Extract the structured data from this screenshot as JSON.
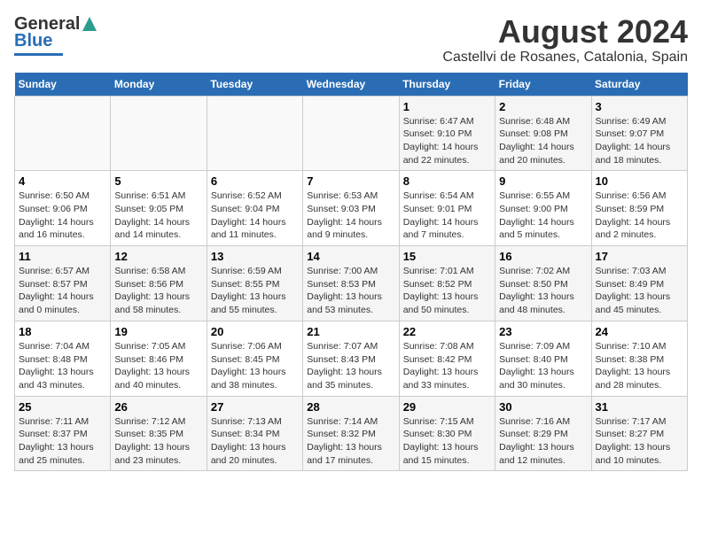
{
  "header": {
    "logo_line1": "General",
    "logo_line2": "Blue",
    "title": "August 2024",
    "subtitle": "Castellvi de Rosanes, Catalonia, Spain"
  },
  "calendar": {
    "days_of_week": [
      "Sunday",
      "Monday",
      "Tuesday",
      "Wednesday",
      "Thursday",
      "Friday",
      "Saturday"
    ],
    "weeks": [
      [
        {
          "day": "",
          "info": ""
        },
        {
          "day": "",
          "info": ""
        },
        {
          "day": "",
          "info": ""
        },
        {
          "day": "",
          "info": ""
        },
        {
          "day": "1",
          "info": "Sunrise: 6:47 AM\nSunset: 9:10 PM\nDaylight: 14 hours\nand 22 minutes."
        },
        {
          "day": "2",
          "info": "Sunrise: 6:48 AM\nSunset: 9:08 PM\nDaylight: 14 hours\nand 20 minutes."
        },
        {
          "day": "3",
          "info": "Sunrise: 6:49 AM\nSunset: 9:07 PM\nDaylight: 14 hours\nand 18 minutes."
        }
      ],
      [
        {
          "day": "4",
          "info": "Sunrise: 6:50 AM\nSunset: 9:06 PM\nDaylight: 14 hours\nand 16 minutes."
        },
        {
          "day": "5",
          "info": "Sunrise: 6:51 AM\nSunset: 9:05 PM\nDaylight: 14 hours\nand 14 minutes."
        },
        {
          "day": "6",
          "info": "Sunrise: 6:52 AM\nSunset: 9:04 PM\nDaylight: 14 hours\nand 11 minutes."
        },
        {
          "day": "7",
          "info": "Sunrise: 6:53 AM\nSunset: 9:03 PM\nDaylight: 14 hours\nand 9 minutes."
        },
        {
          "day": "8",
          "info": "Sunrise: 6:54 AM\nSunset: 9:01 PM\nDaylight: 14 hours\nand 7 minutes."
        },
        {
          "day": "9",
          "info": "Sunrise: 6:55 AM\nSunset: 9:00 PM\nDaylight: 14 hours\nand 5 minutes."
        },
        {
          "day": "10",
          "info": "Sunrise: 6:56 AM\nSunset: 8:59 PM\nDaylight: 14 hours\nand 2 minutes."
        }
      ],
      [
        {
          "day": "11",
          "info": "Sunrise: 6:57 AM\nSunset: 8:57 PM\nDaylight: 14 hours\nand 0 minutes."
        },
        {
          "day": "12",
          "info": "Sunrise: 6:58 AM\nSunset: 8:56 PM\nDaylight: 13 hours\nand 58 minutes."
        },
        {
          "day": "13",
          "info": "Sunrise: 6:59 AM\nSunset: 8:55 PM\nDaylight: 13 hours\nand 55 minutes."
        },
        {
          "day": "14",
          "info": "Sunrise: 7:00 AM\nSunset: 8:53 PM\nDaylight: 13 hours\nand 53 minutes."
        },
        {
          "day": "15",
          "info": "Sunrise: 7:01 AM\nSunset: 8:52 PM\nDaylight: 13 hours\nand 50 minutes."
        },
        {
          "day": "16",
          "info": "Sunrise: 7:02 AM\nSunset: 8:50 PM\nDaylight: 13 hours\nand 48 minutes."
        },
        {
          "day": "17",
          "info": "Sunrise: 7:03 AM\nSunset: 8:49 PM\nDaylight: 13 hours\nand 45 minutes."
        }
      ],
      [
        {
          "day": "18",
          "info": "Sunrise: 7:04 AM\nSunset: 8:48 PM\nDaylight: 13 hours\nand 43 minutes."
        },
        {
          "day": "19",
          "info": "Sunrise: 7:05 AM\nSunset: 8:46 PM\nDaylight: 13 hours\nand 40 minutes."
        },
        {
          "day": "20",
          "info": "Sunrise: 7:06 AM\nSunset: 8:45 PM\nDaylight: 13 hours\nand 38 minutes."
        },
        {
          "day": "21",
          "info": "Sunrise: 7:07 AM\nSunset: 8:43 PM\nDaylight: 13 hours\nand 35 minutes."
        },
        {
          "day": "22",
          "info": "Sunrise: 7:08 AM\nSunset: 8:42 PM\nDaylight: 13 hours\nand 33 minutes."
        },
        {
          "day": "23",
          "info": "Sunrise: 7:09 AM\nSunset: 8:40 PM\nDaylight: 13 hours\nand 30 minutes."
        },
        {
          "day": "24",
          "info": "Sunrise: 7:10 AM\nSunset: 8:38 PM\nDaylight: 13 hours\nand 28 minutes."
        }
      ],
      [
        {
          "day": "25",
          "info": "Sunrise: 7:11 AM\nSunset: 8:37 PM\nDaylight: 13 hours\nand 25 minutes."
        },
        {
          "day": "26",
          "info": "Sunrise: 7:12 AM\nSunset: 8:35 PM\nDaylight: 13 hours\nand 23 minutes."
        },
        {
          "day": "27",
          "info": "Sunrise: 7:13 AM\nSunset: 8:34 PM\nDaylight: 13 hours\nand 20 minutes."
        },
        {
          "day": "28",
          "info": "Sunrise: 7:14 AM\nSunset: 8:32 PM\nDaylight: 13 hours\nand 17 minutes."
        },
        {
          "day": "29",
          "info": "Sunrise: 7:15 AM\nSunset: 8:30 PM\nDaylight: 13 hours\nand 15 minutes."
        },
        {
          "day": "30",
          "info": "Sunrise: 7:16 AM\nSunset: 8:29 PM\nDaylight: 13 hours\nand 12 minutes."
        },
        {
          "day": "31",
          "info": "Sunrise: 7:17 AM\nSunset: 8:27 PM\nDaylight: 13 hours\nand 10 minutes."
        }
      ]
    ]
  }
}
